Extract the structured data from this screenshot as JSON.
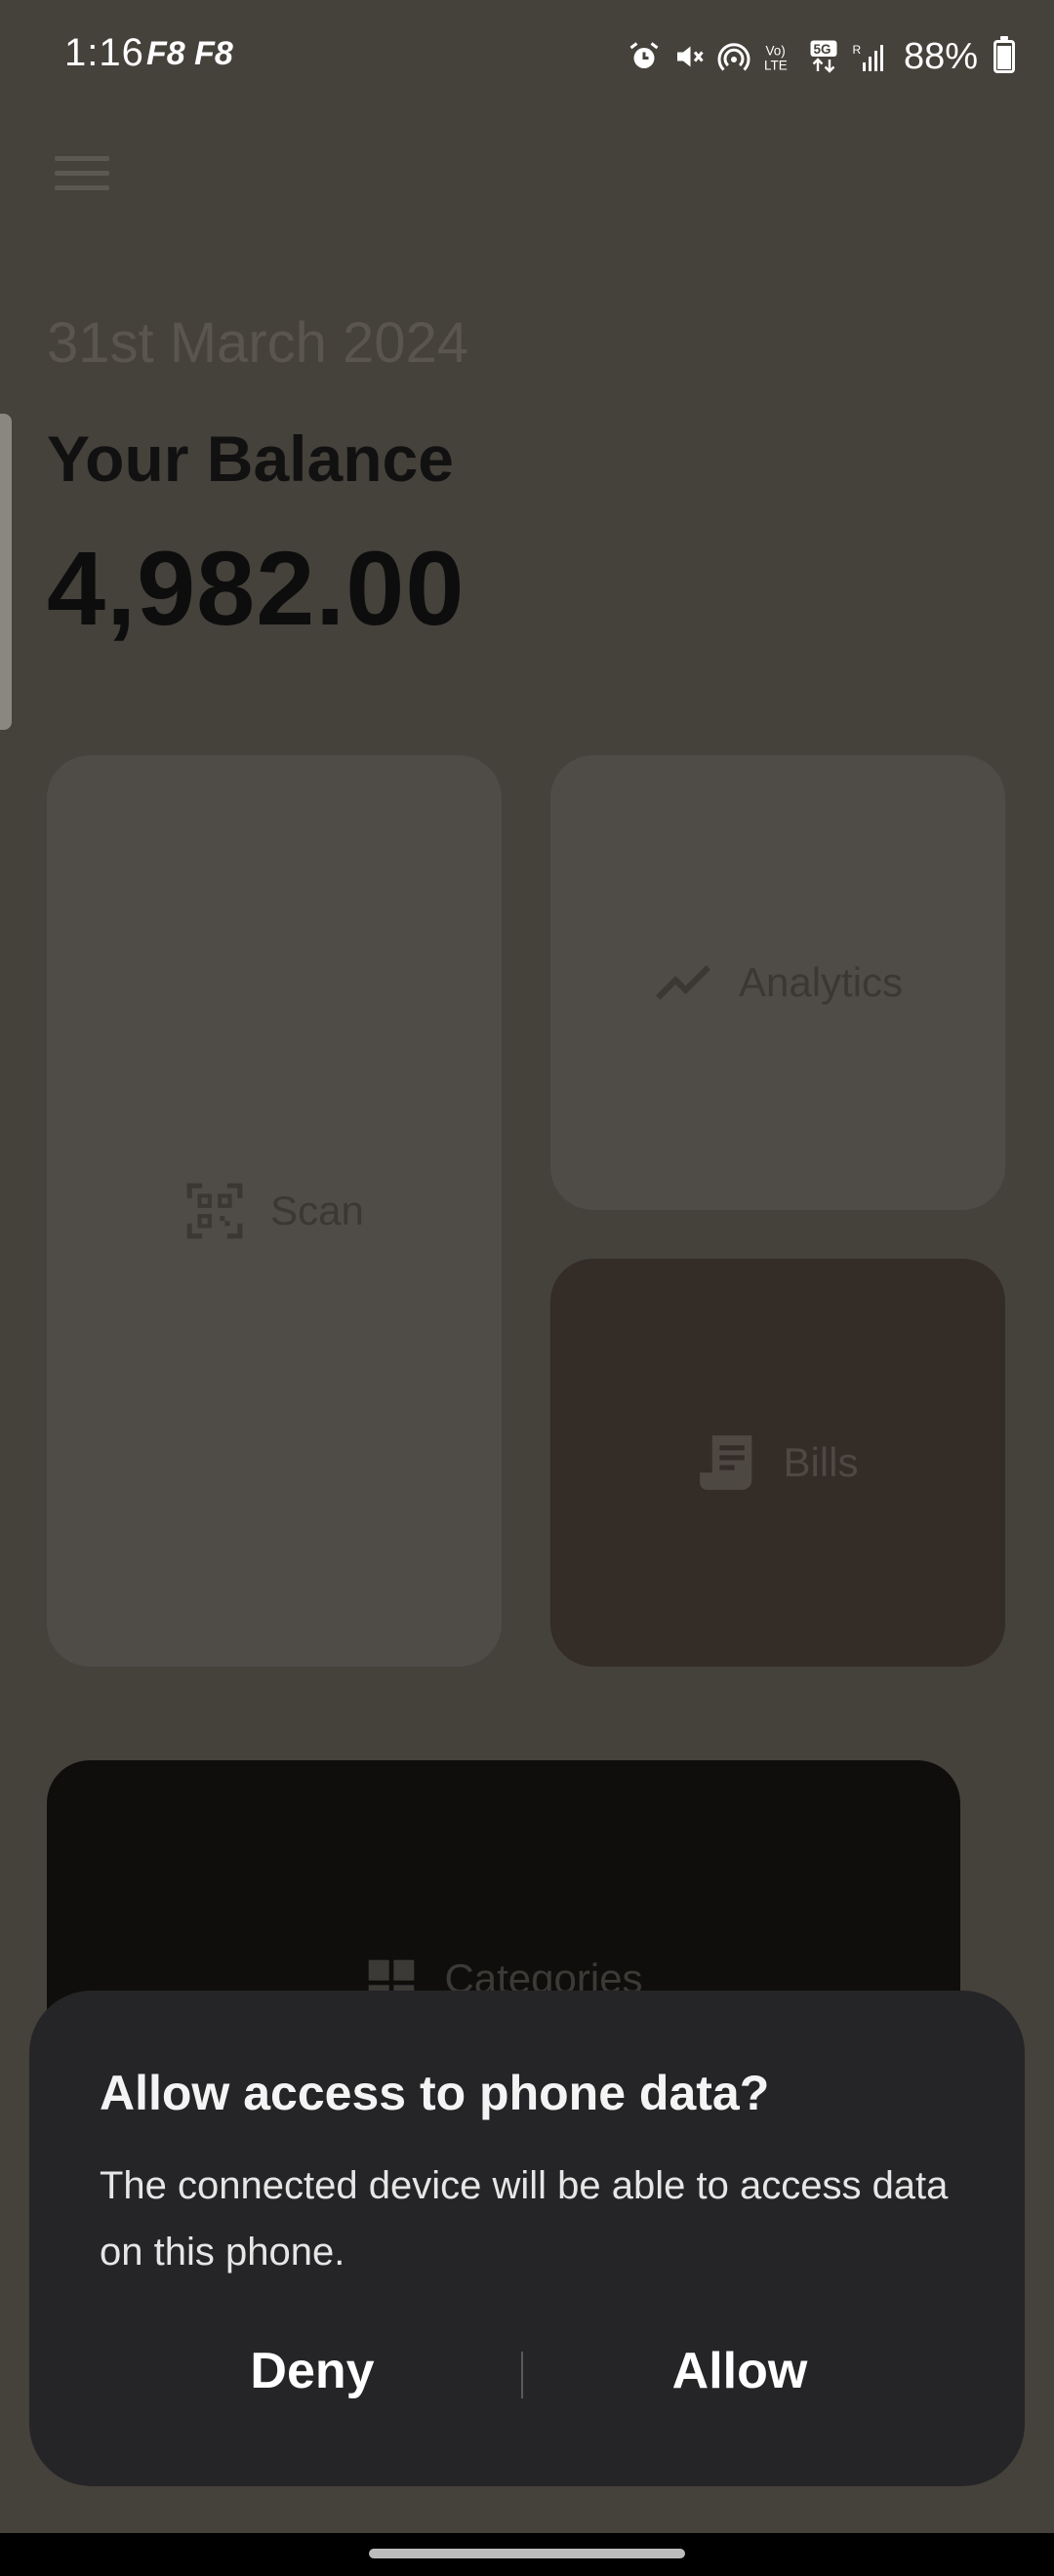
{
  "status_bar": {
    "time": "1:16",
    "app_indicators": "F8 F8",
    "battery_percent": "88%",
    "icons": [
      "alarm-icon",
      "mute-icon",
      "hotspot-icon",
      "volte-icon",
      "5g-icon",
      "signal-icon",
      "battery-charging-icon"
    ]
  },
  "header": {
    "date": "31st March 2024",
    "balance_label": "Your Balance",
    "balance_value": "4,982.00"
  },
  "tiles": {
    "scan": "Scan",
    "analytics": "Analytics",
    "bills": "Bills",
    "categories": "Categories"
  },
  "dialog": {
    "title": "Allow access to phone data?",
    "body": "The connected device will be able to access data on this phone.",
    "deny_label": "Deny",
    "allow_label": "Allow"
  },
  "colors": {
    "background": "#45413b",
    "dialog": "#252527",
    "bills_tile": "#332c27",
    "categories_tile": "#100e0c"
  }
}
